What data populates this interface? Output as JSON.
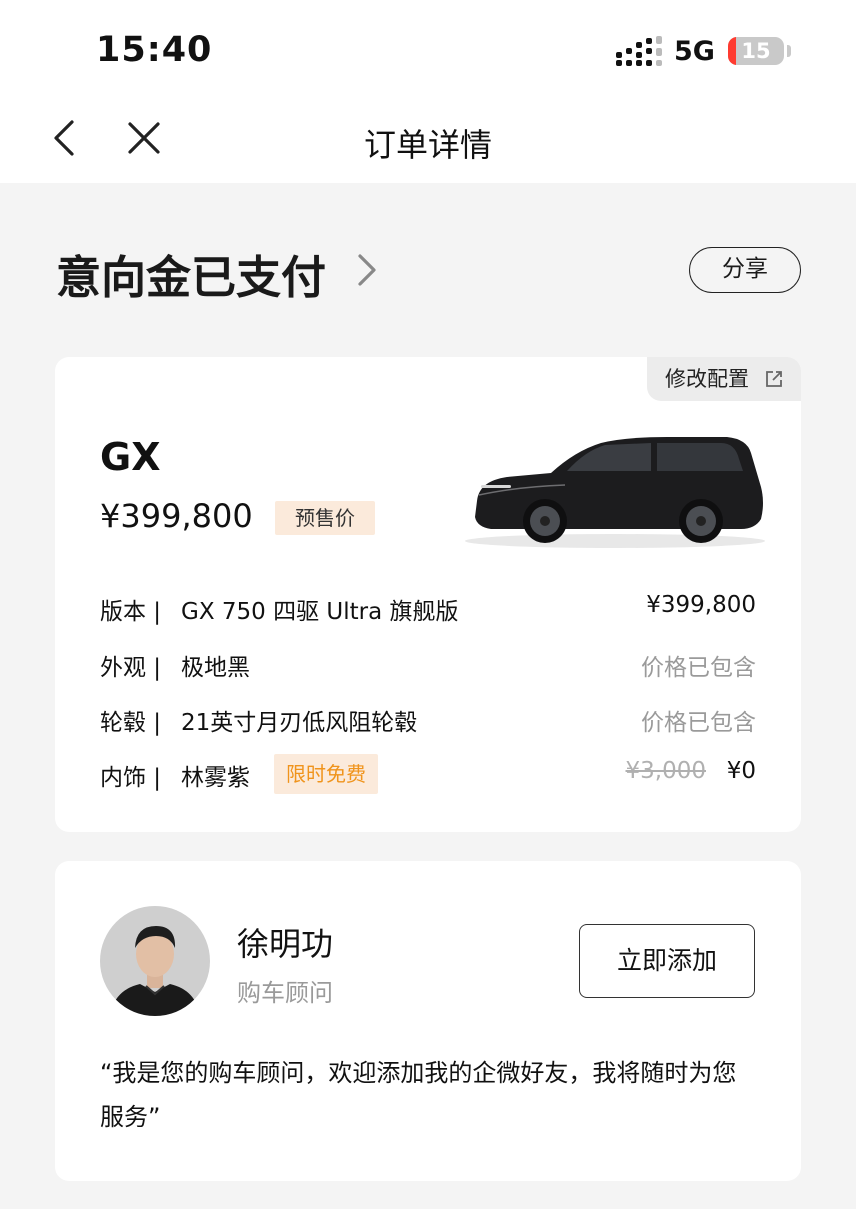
{
  "status_bar": {
    "time": "15:40",
    "network": "5G",
    "battery": "15",
    "battery_level": 0.15,
    "signal_icon": "signal-icon",
    "battery_icon": "battery-icon"
  },
  "nav": {
    "title": "订单详情",
    "back_icon": "chevron-left-icon",
    "close_icon": "close-icon"
  },
  "header": {
    "status_text": "意向金已支付",
    "chevron_icon": "chevron-right-icon",
    "share_label": "分享"
  },
  "car_card": {
    "modify_label": "修改配置",
    "modify_icon": "external-link-icon",
    "model": "GX",
    "price": "¥399,800",
    "price_tag": "预售价",
    "rows": [
      {
        "label": "版本 |",
        "value": "GX 750 四驱 Ultra 旗舰版",
        "price": "¥399,800"
      },
      {
        "label": "外观 |",
        "value": "极地黑",
        "price": "价格已包含"
      },
      {
        "label": "轮毂 |",
        "value": "21英寸月刃低风阻轮毂",
        "price": "价格已包含"
      },
      {
        "label": "内饰 |",
        "value": "林雾紫",
        "tag": "限时免费",
        "original_price": "¥3,000",
        "price": "¥0"
      }
    ]
  },
  "advisor_card": {
    "name": "徐明功",
    "role": "购车顾问",
    "add_label": "立即添加",
    "message": "“我是您的购车顾问，欢迎添加我的企微好友，我将随时为您服务”"
  },
  "colors": {
    "accent_tag_bg": "#fbeadb",
    "accent_orange": "#f0941c",
    "page_bg": "#f4f4f4",
    "battery_red": "#ff3b30"
  }
}
